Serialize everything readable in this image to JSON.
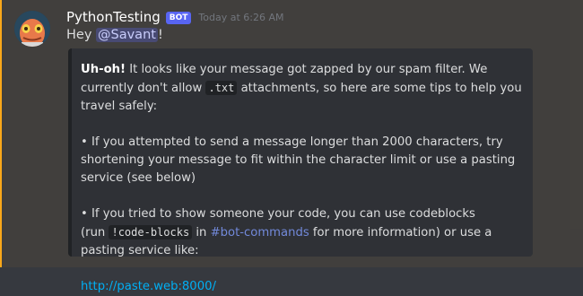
{
  "message": {
    "author": "PythonTesting",
    "bot_tag": "BOT",
    "timestamp": "Today at 6:26 AM",
    "greeting": "Hey ",
    "mention": "@Savant",
    "greeting_end": "!"
  },
  "embed": {
    "bold_lead": "Uh-oh!",
    "p1_text_a": " It looks like your message got zapped by our spam filter. We currently don't allow ",
    "p1_code": ".txt",
    "p1_text_b": " attachments, so here are some tips to help you travel safely:",
    "p2": "• If you attempted to send a message longer than 2000 characters, try shortening your message to fit within the character limit or use a pasting service (see below)",
    "p3_text_a": "• If you tried to show someone your code, you can use codeblocks",
    "p3_text_b": "(run ",
    "p3_code": "!code-blocks",
    "p3_text_c": " in ",
    "p3_channel": "#bot-commands",
    "p3_text_d": " for more information) or use a pasting service like:",
    "link": "http://paste.web:8000/"
  },
  "colors": {
    "background": "#36393f",
    "embed_bg": "#2f3136",
    "mention_stripe": "#faa81a",
    "link": "#00aff4",
    "bot_tag": "#5865f2"
  }
}
